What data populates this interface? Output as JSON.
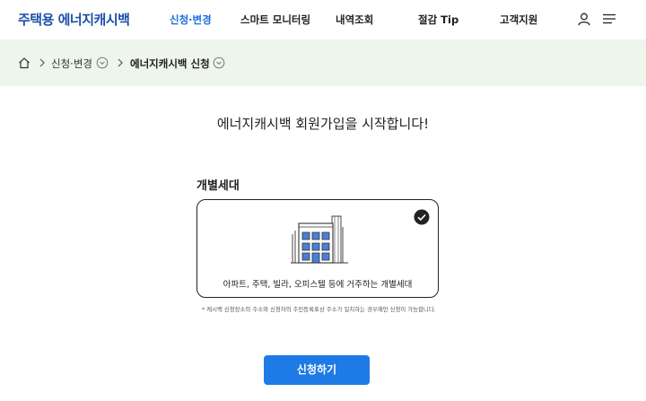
{
  "header": {
    "logo": "주택용 에너지캐시백",
    "nav": [
      {
        "label": "신청·변경",
        "active": true
      },
      {
        "label": "스마트 모니터링",
        "active": false
      },
      {
        "label": "내역조회",
        "active": false
      },
      {
        "label": "절감 Tip",
        "active": false
      },
      {
        "label": "고객지원",
        "active": false
      }
    ],
    "icons": [
      "user-icon",
      "menu-icon"
    ]
  },
  "breadcrumb": {
    "icons": [
      "home-icon",
      "chevron-right-icon",
      "chevron-down-circle-icon"
    ],
    "items": [
      "신청·변경",
      "에너지캐시백 신청"
    ]
  },
  "main": {
    "title": "에너지캐시백 회원가입을 시작합니다!",
    "section_label": "개별세대",
    "option": {
      "label": "아파트, 주택, 빌라, 오피스텔 등에 거주하는 개별세대",
      "selected": true,
      "icon": "building-icon"
    },
    "note": "* 캐시백 신청장소의 주소와 신청자의 주민등록표상 주소가 일치하는 경우에만 신청이 가능합니다.",
    "submit_label": "신청하기"
  },
  "colors": {
    "brand": "#1d4fa8",
    "accent": "#1e6fe0",
    "button": "#1e7be6",
    "breadcrumb_bg": "#eef5ea"
  }
}
